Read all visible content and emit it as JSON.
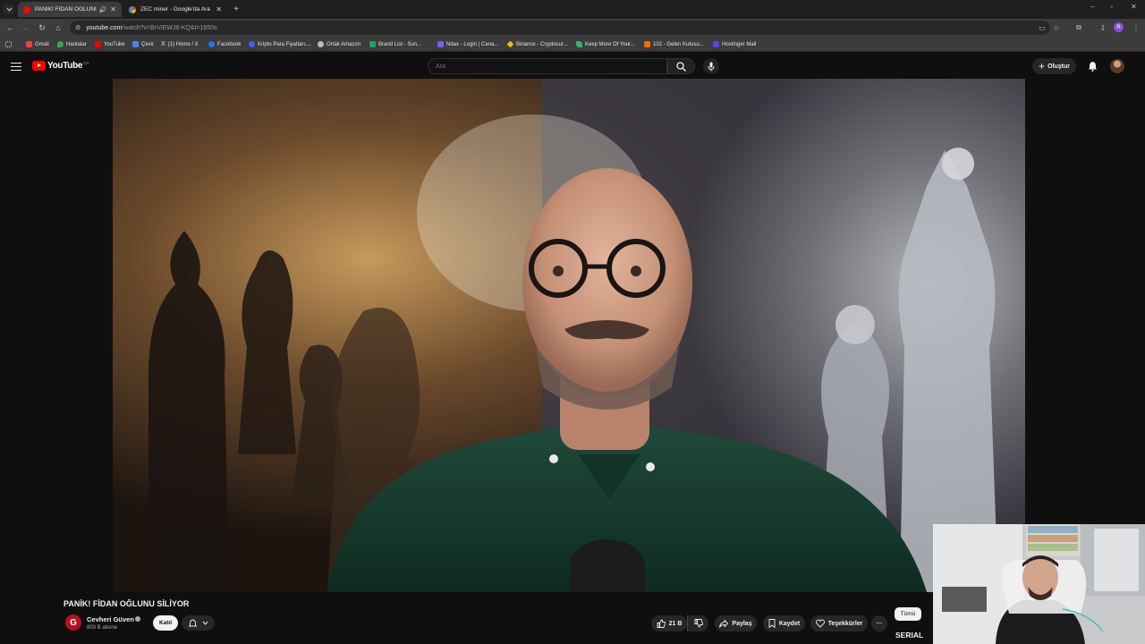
{
  "browser": {
    "tabs": [
      {
        "title": "PANİK! FİDAN OĞLUNU Sİ",
        "active": true
      },
      {
        "title": "ZEC miner - Google'da Ara",
        "active": false
      }
    ],
    "new_tab": "+",
    "address": {
      "host": "youtube.com",
      "path": "/watch?v=BrVIEWJ6-KQ&t=1650s"
    },
    "bookmarks": [
      {
        "label": "Gmail",
        "icon": "gmail-icon",
        "color": "#ea4335"
      },
      {
        "label": "Haritalar",
        "icon": "maps-icon",
        "color": "#34a853"
      },
      {
        "label": "YouTube",
        "icon": "youtube-icon",
        "color": "#ff0000"
      },
      {
        "label": "Çevir",
        "icon": "translate-icon",
        "color": "#4285f4"
      },
      {
        "label": "(1) Home / X",
        "icon": "x-icon",
        "color": "#000000"
      },
      {
        "label": "Facebook",
        "icon": "facebook-icon",
        "color": "#1877f2"
      },
      {
        "label": "Kripto Para Fiyatları,...",
        "icon": "coin-icon",
        "color": "#3861fb"
      },
      {
        "label": "Ortak Amazon",
        "icon": "globe-icon",
        "color": "#bbbbbb"
      },
      {
        "label": "Brand List - Sun...",
        "icon": "sheet-icon",
        "color": "#1fa463"
      },
      {
        "label": "Ndax - Login | Cana...",
        "icon": "ndax-icon",
        "color": "#7b5cff"
      },
      {
        "label": "Binance - Cryptocur...",
        "icon": "binance-icon",
        "color": "#f0b90b"
      },
      {
        "label": "Keep More Of Your...",
        "icon": "leaf-icon",
        "color": "#2fb36a"
      },
      {
        "label": "102 - Gelen Kutusu...",
        "icon": "mail-icon",
        "color": "#ff6a00"
      },
      {
        "label": "Hostinger Mail",
        "icon": "hostinger-icon",
        "color": "#673de6"
      }
    ]
  },
  "youtube": {
    "logo_text": "YouTube",
    "country": "CA",
    "search_placeholder": "Ara",
    "create_label": "Oluştur",
    "video_title": "PANİK! FİDAN OĞLUNU SİLİYOR",
    "channel": {
      "name": "Cevheri Güven",
      "subscribers": "803 B abone",
      "avatar_letter": "G"
    },
    "join_label": "Katıl",
    "likes": "21 B",
    "share_label": "Paylaş",
    "save_label": "Kaydet",
    "thanks_label": "Teşekkürler",
    "more_label": "···",
    "chip_all": "Tümü",
    "sidebar_text": "SERIAL"
  }
}
